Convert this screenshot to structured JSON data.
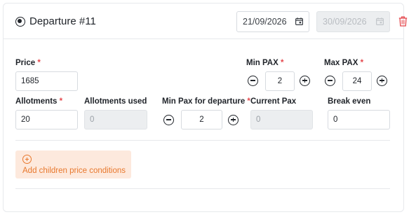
{
  "departure": {
    "title": "Departure #11",
    "start_date": "21/09/2026",
    "end_date": "30/09/2026"
  },
  "fields": {
    "price": {
      "label": "Price",
      "required_mark": "*",
      "value": "1685"
    },
    "min_pax": {
      "label": "Min PAX",
      "required_mark": "*",
      "value": "2"
    },
    "max_pax": {
      "label": "Max PAX",
      "required_mark": "*",
      "value": "24"
    },
    "allotments": {
      "label": "Allotments",
      "required_mark": "*",
      "value": "20"
    },
    "allotments_used": {
      "label": "Allotments used",
      "value": "0"
    },
    "min_pax_departure": {
      "label": "Min Pax for departure",
      "required_mark": "*",
      "value": "2"
    },
    "current_pax": {
      "label": "Current Pax",
      "value": "0"
    },
    "break_even": {
      "label": "Break even",
      "value": "0"
    }
  },
  "actions": {
    "add_children_label": "Add children price conditions"
  },
  "icons": {
    "radio": "radio-selected-icon",
    "calendar": "calendar-icon",
    "delete": "trash-icon",
    "decrement": "minus-circle-icon",
    "increment": "plus-circle-icon",
    "add": "plus-circle-icon"
  },
  "colors": {
    "required": "#e5484d",
    "accent": "#e8782d",
    "accent_bg": "#fde9dd",
    "delete": "#e5484d",
    "disabled_bg": "#eceef0"
  }
}
